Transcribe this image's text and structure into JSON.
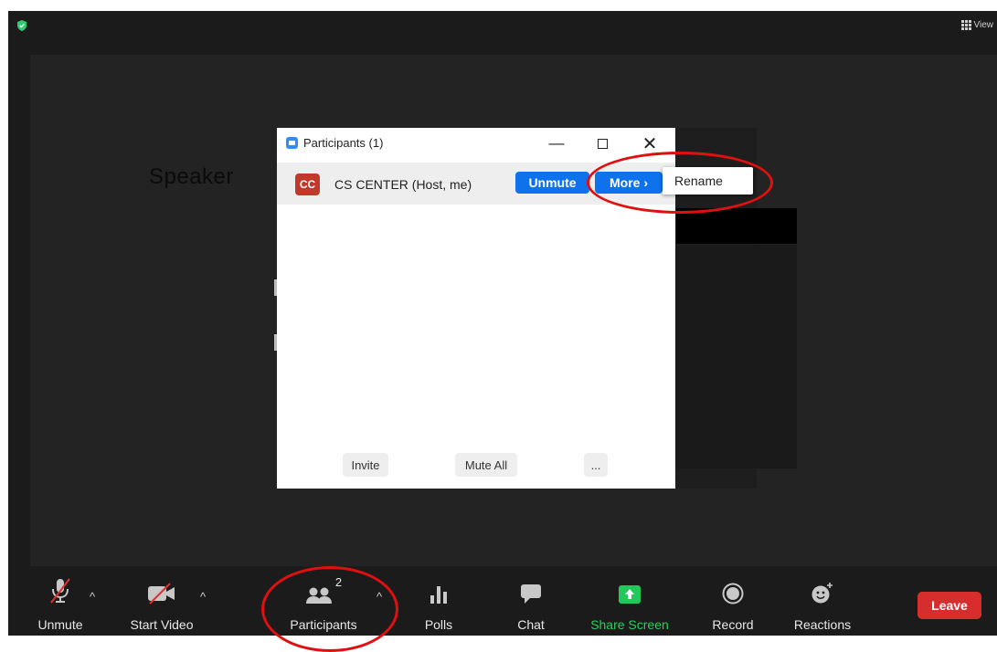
{
  "window": {
    "view_label": "View"
  },
  "stage": {
    "speaker_label": "Speaker"
  },
  "participants_panel": {
    "title": "Participants (1)",
    "window_controls": [
      "minimize-icon",
      "maximize-icon",
      "close-icon"
    ],
    "participant": {
      "initials": "CC",
      "name": "CS CENTER (Host, me)",
      "unmute_label": "Unmute",
      "more_label": "More ›"
    },
    "context_menu": {
      "rename_label": "Rename"
    },
    "footer": {
      "invite_label": "Invite",
      "mute_all_label": "Mute All",
      "more_label": "..."
    }
  },
  "toolbar": {
    "unmute_label": "Unmute",
    "start_video_label": "Start Video",
    "participants_label": "Participants",
    "participants_count": "2",
    "polls_label": "Polls",
    "chat_label": "Chat",
    "share_screen_label": "Share Screen",
    "record_label": "Record",
    "reactions_label": "Reactions",
    "leave_label": "Leave"
  },
  "colors": {
    "accent_blue": "#0e72ed",
    "leave_red": "#d72d2d",
    "share_green": "#22d35a",
    "annotation_red": "#e01010",
    "avatar_red": "#c0392b"
  }
}
